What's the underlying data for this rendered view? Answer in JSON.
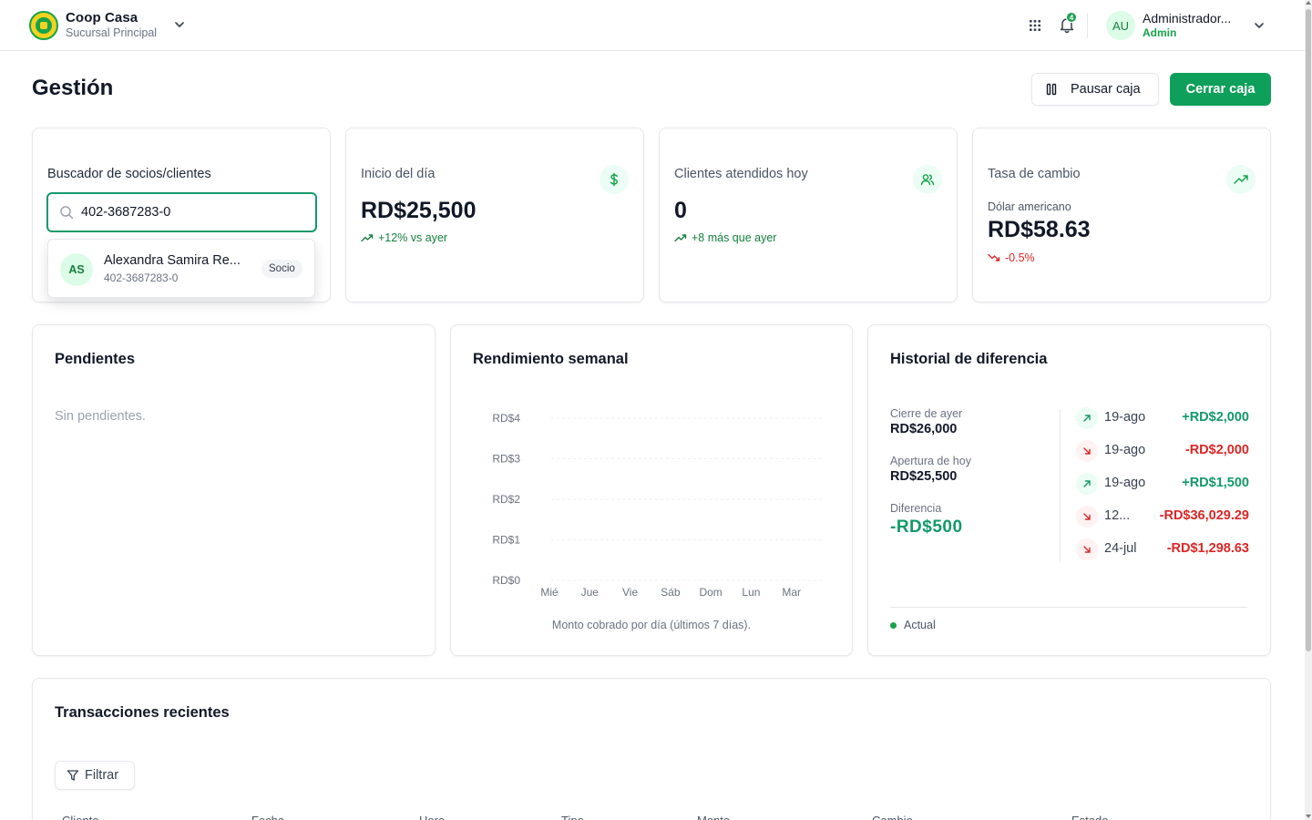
{
  "header": {
    "brand_name": "Coop Casa",
    "brand_sub": "Sucursal Principal",
    "notification_count": "4",
    "user_initials": "AU",
    "user_name": "Administrador...",
    "user_role": "Admin"
  },
  "page": {
    "title": "Gestión",
    "pause_label": "Pausar caja",
    "close_label": "Cerrar caja"
  },
  "search": {
    "label": "Buscador de socios/clientes",
    "value": "402-3687283-0",
    "result": {
      "initials": "AS",
      "name": "Alexandra Samira Re...",
      "id": "402-3687283-0",
      "badge": "Socio"
    }
  },
  "stats": {
    "inicio": {
      "title": "Inicio del día",
      "value": "RD$25,500",
      "trend": "+12% vs ayer"
    },
    "clientes": {
      "title": "Clientes atendidos hoy",
      "value": "0",
      "trend": "+8 más que ayer"
    },
    "tasa": {
      "title": "Tasa de cambio",
      "sub": "Dólar americano",
      "value": "RD$58.63",
      "trend": "-0.5%"
    }
  },
  "pendientes": {
    "title": "Pendientes",
    "empty": "Sin pendientes."
  },
  "rendimiento": {
    "title": "Rendimiento semanal",
    "caption": "Monto cobrado por día (últimos 7 días)."
  },
  "chart_data": {
    "type": "bar",
    "title": "Rendimiento semanal",
    "categories": [
      "Mié",
      "Jue",
      "Vie",
      "Sáb",
      "Dom",
      "Lun",
      "Mar"
    ],
    "values": [
      0,
      0,
      0,
      0,
      0,
      0,
      0
    ],
    "yticks": [
      "RD$0",
      "RD$1",
      "RD$2",
      "RD$3",
      "RD$4"
    ],
    "ylim": [
      0,
      4
    ],
    "grid": true
  },
  "historial": {
    "title": "Historial de diferencia",
    "cierre_label": "Cierre de ayer",
    "cierre_value": "RD$26,000",
    "apertura_label": "Apertura de hoy",
    "apertura_value": "RD$25,500",
    "diferencia_label": "Diferencia",
    "diferencia_value": "-RD$500",
    "legend": "Actual",
    "rows": [
      {
        "date": "19-ago",
        "amount": "+RD$2,000",
        "dir": "up"
      },
      {
        "date": "19-ago",
        "amount": "-RD$2,000",
        "dir": "down"
      },
      {
        "date": "19-ago",
        "amount": "+RD$1,500",
        "dir": "up"
      },
      {
        "date": "12...",
        "amount": "-RD$36,029.29",
        "dir": "down"
      },
      {
        "date": "24-jul",
        "amount": "-RD$1,298.63",
        "dir": "down"
      }
    ]
  },
  "transacciones": {
    "title": "Transacciones recientes",
    "filter_label": "Filtrar",
    "columns": [
      "Cliente",
      "Fecha",
      "Hora",
      "Tipo",
      "Monto",
      "Cambio",
      "Estado"
    ]
  },
  "colors": {
    "accent": "#0e9f5b",
    "positive": "#13996a",
    "negative": "#dc2626"
  }
}
